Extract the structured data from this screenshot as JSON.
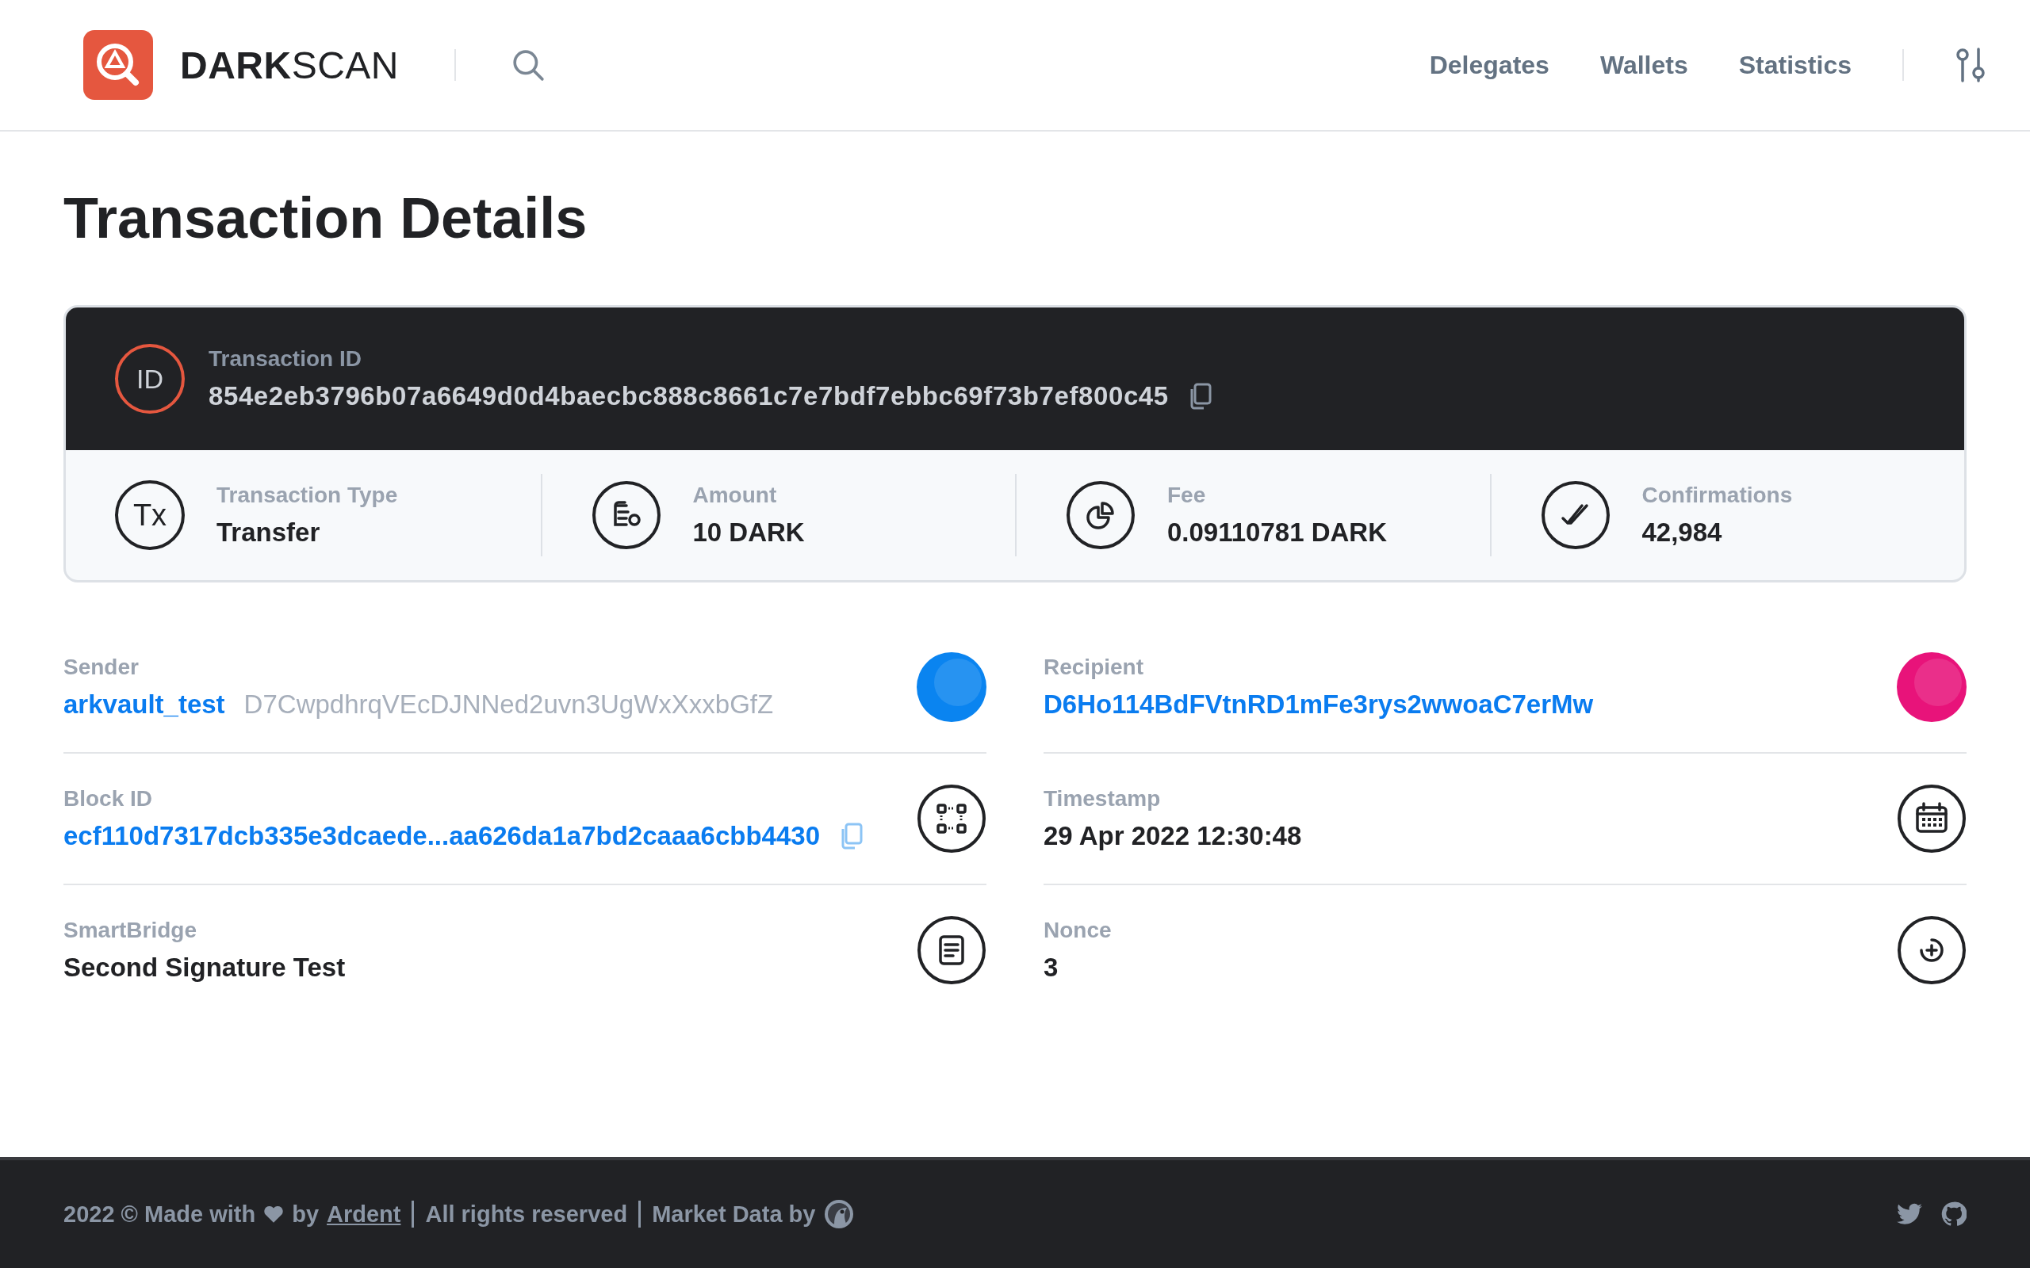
{
  "header": {
    "logo_text": "**DARK**SCAN",
    "nav": [
      {
        "label": "Delegates"
      },
      {
        "label": "Wallets"
      },
      {
        "label": "Statistics"
      }
    ]
  },
  "title": "Transaction Details",
  "transaction": {
    "badge": "ID",
    "label": "Transaction ID",
    "value": "854e2eb3796b07a6649d0d4baecbc888c8661c7e7bdf7ebbc69f73b7ef800c45",
    "copyable": true
  },
  "stats": [
    {
      "kind": "type",
      "badge": "Tx",
      "label": "Transaction Type",
      "value": "Transfer"
    },
    {
      "kind": "amount",
      "label": "Amount",
      "value": "10 DARK"
    },
    {
      "kind": "fee",
      "label": "Fee",
      "value": "0.09110781 DARK"
    },
    {
      "kind": "confirmations",
      "label": "Confirmations",
      "value": "42,984"
    }
  ],
  "details": [
    {
      "label": "Sender",
      "name": "arkvault_test",
      "value": "D7CwpdhrqVEcDJNNed2uvn3UgWxXxxbGfZ",
      "link": false,
      "copyable": false,
      "icon": {
        "kind": "avatar",
        "color": "#0a84f0"
      }
    },
    {
      "label": "Recipient",
      "value": "D6Ho114BdFVtnRD1mFe3rys2wwoaC7erMw",
      "link": true,
      "copyable": false,
      "icon": {
        "kind": "avatar",
        "color": "#e8137a"
      }
    },
    {
      "label": "Block ID",
      "value": "ecf110d7317dcb335e3dcaede...aa626da1a7bd2caaa6cbb4430",
      "link": true,
      "copyable": true,
      "icon": {
        "kind": "block"
      }
    },
    {
      "label": "Timestamp",
      "value": "29 Apr 2022 12:30:48",
      "link": false,
      "copyable": false,
      "icon": {
        "kind": "calendar"
      }
    },
    {
      "label": "SmartBridge",
      "value": "Second Signature Test",
      "link": false,
      "copyable": false,
      "icon": {
        "kind": "document"
      }
    },
    {
      "label": "Nonce",
      "value": "3",
      "link": false,
      "copyable": false,
      "icon": {
        "kind": "nonce"
      }
    }
  ],
  "footer": {
    "made_with": "2022 © Made with",
    "by": "by",
    "author": "Ardent",
    "rights": "All rights reserved",
    "market": "Market Data by"
  }
}
